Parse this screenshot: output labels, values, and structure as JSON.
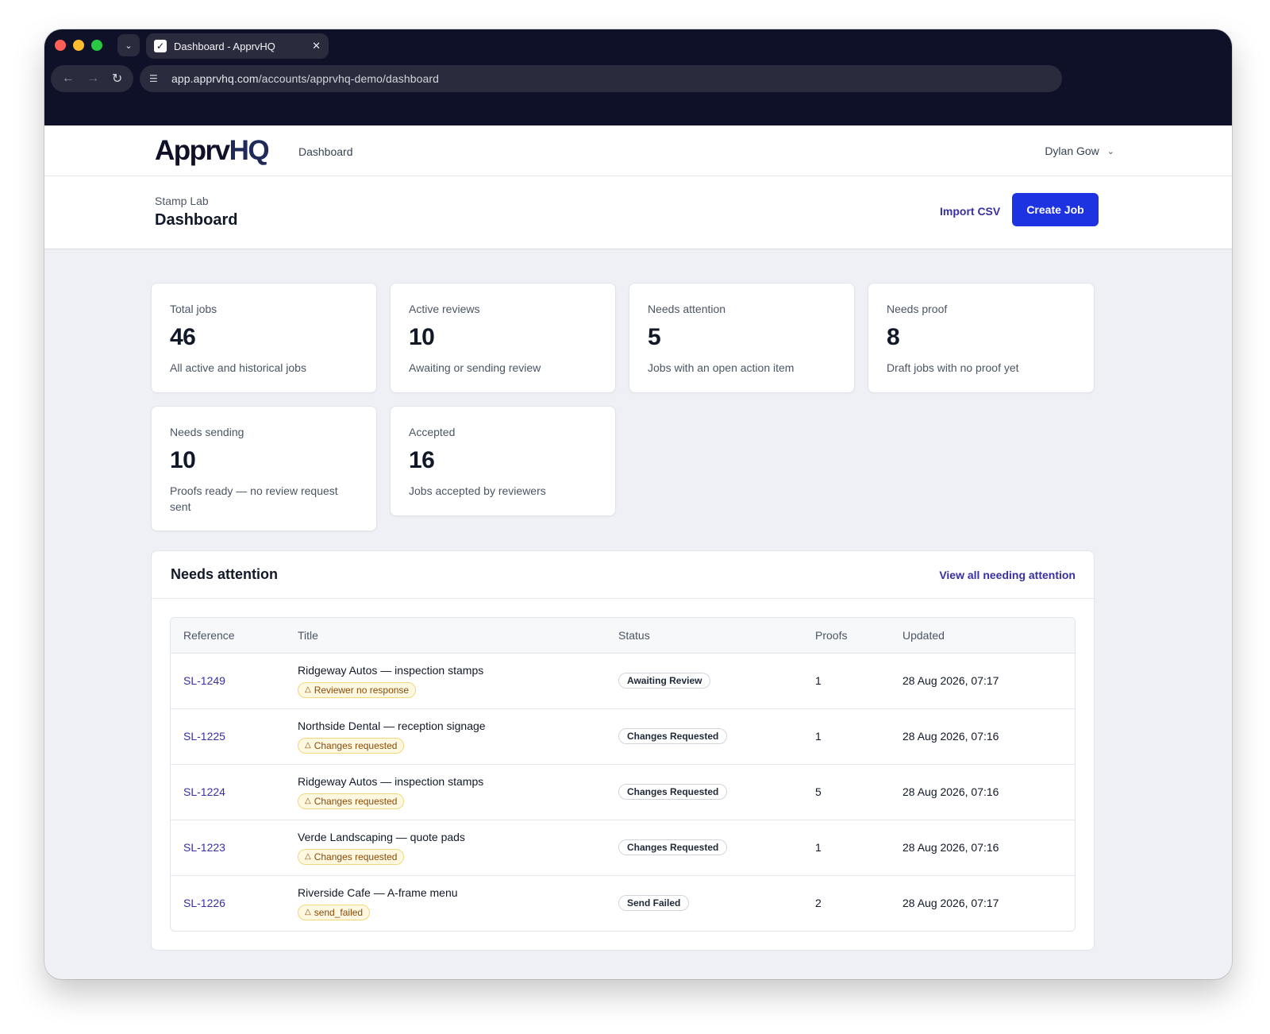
{
  "browser": {
    "tab_title": "Dashboard - ApprvHQ",
    "tab_close": "✕",
    "url_host": "app.apprvhq.com",
    "url_path": "/accounts/apprvhq-demo/dashboard"
  },
  "app": {
    "logo_main": "Apprv",
    "logo_accent": "HQ",
    "nav_dashboard": "Dashboard",
    "user_name": "Dylan Gow"
  },
  "page": {
    "breadcrumb": "Stamp Lab",
    "title": "Dashboard",
    "import_label": "Import CSV",
    "create_label": "Create Job"
  },
  "stats": [
    {
      "label": "Total jobs",
      "value": "46",
      "desc": "All active and historical jobs"
    },
    {
      "label": "Active reviews",
      "value": "10",
      "desc": "Awaiting or sending review"
    },
    {
      "label": "Needs attention",
      "value": "5",
      "desc": "Jobs with an open action item"
    },
    {
      "label": "Needs proof",
      "value": "8",
      "desc": "Draft jobs with no proof yet"
    },
    {
      "label": "Needs sending",
      "value": "10",
      "desc": "Proofs ready — no review request sent"
    },
    {
      "label": "Accepted",
      "value": "16",
      "desc": "Jobs accepted by reviewers"
    }
  ],
  "attention": {
    "title": "Needs attention",
    "view_all": "View all needing attention",
    "columns": [
      "Reference",
      "Title",
      "Status",
      "Proofs",
      "Updated"
    ],
    "rows": [
      {
        "ref": "SL-1249",
        "title": "Ridgeway Autos — inspection stamps",
        "flag": "Reviewer no response",
        "status": "Awaiting Review",
        "proofs": "1",
        "updated": "28 Aug 2026, 07:17"
      },
      {
        "ref": "SL-1225",
        "title": "Northside Dental — reception signage",
        "flag": "Changes requested",
        "status": "Changes Requested",
        "proofs": "1",
        "updated": "28 Aug 2026, 07:16"
      },
      {
        "ref": "SL-1224",
        "title": "Ridgeway Autos — inspection stamps",
        "flag": "Changes requested",
        "status": "Changes Requested",
        "proofs": "5",
        "updated": "28 Aug 2026, 07:16"
      },
      {
        "ref": "SL-1223",
        "title": "Verde Landscaping — quote pads",
        "flag": "Changes requested",
        "status": "Changes Requested",
        "proofs": "1",
        "updated": "28 Aug 2026, 07:16"
      },
      {
        "ref": "SL-1226",
        "title": "Riverside Cafe — A-frame menu",
        "flag": "send_failed",
        "status": "Send Failed",
        "proofs": "2",
        "updated": "28 Aug 2026, 07:17"
      }
    ]
  },
  "colors": {
    "chrome_bg": "#0f1129",
    "accent": "#1d32e0",
    "link": "#3730a3",
    "warning_bg": "#fef8e0"
  }
}
